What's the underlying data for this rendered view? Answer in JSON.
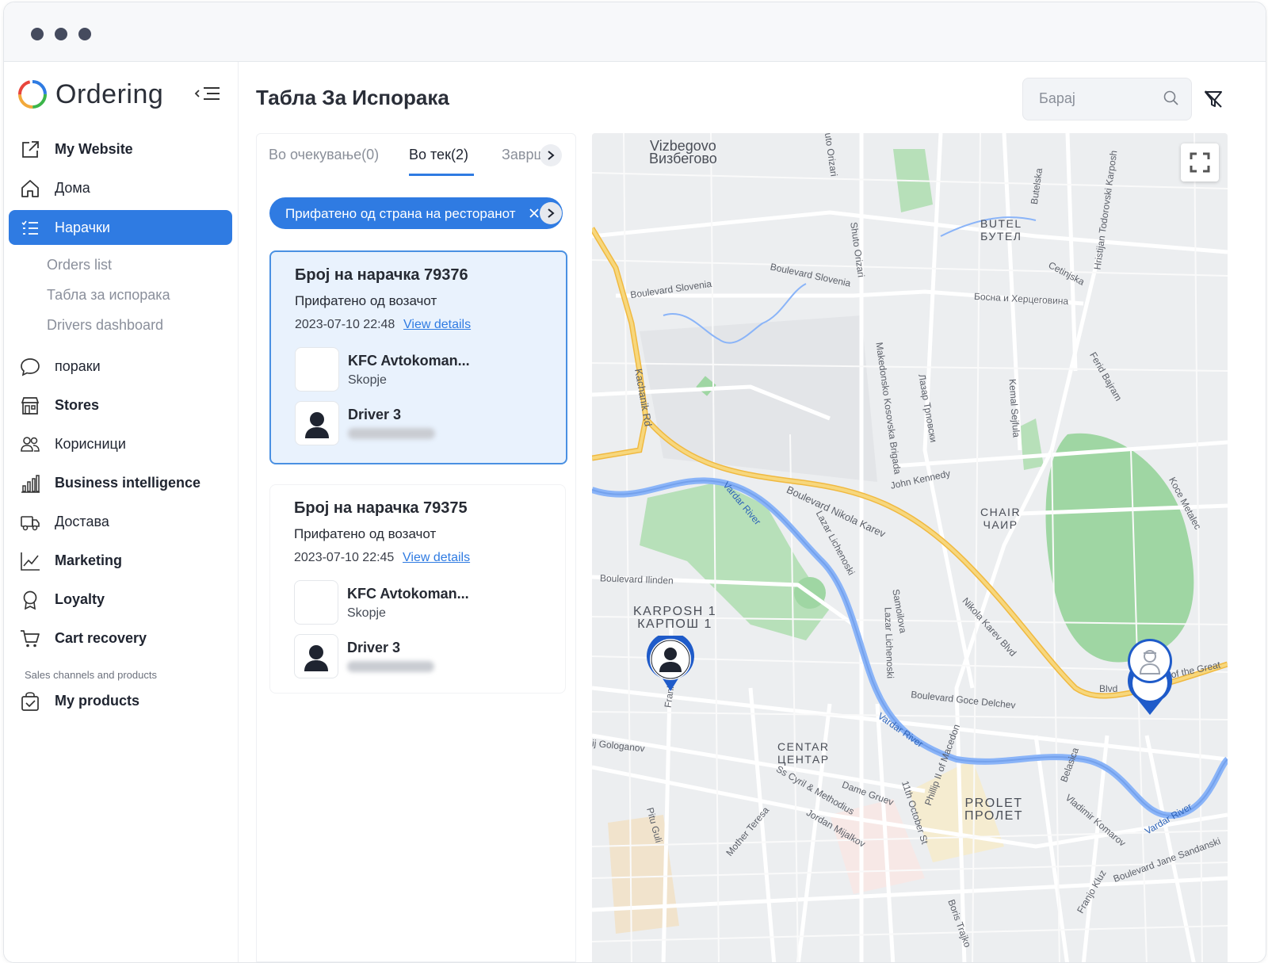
{
  "app": {
    "name": "Ordering"
  },
  "sidebar": {
    "top_items": [
      {
        "label": "My Website",
        "icon": "external-link-icon"
      },
      {
        "label": "Дома",
        "icon": "home-icon"
      },
      {
        "label": "Нарачки",
        "icon": "list-icon",
        "active": true
      }
    ],
    "sub_items": [
      "Orders list",
      "Табла за испорака",
      "Drivers dashboard"
    ],
    "items": [
      {
        "label": "пораки",
        "icon": "chat-bubble-icon"
      },
      {
        "label": "Stores",
        "icon": "store-icon"
      },
      {
        "label": "Корисници",
        "icon": "users-icon"
      },
      {
        "label": "Business intelligence",
        "icon": "bar-chart-icon"
      },
      {
        "label": "Достава",
        "icon": "truck-icon"
      },
      {
        "label": "Marketing",
        "icon": "line-chart-icon"
      },
      {
        "label": "Loyalty",
        "icon": "award-icon"
      },
      {
        "label": "Cart recovery",
        "icon": "cart-icon"
      }
    ],
    "section_label": "Sales channels and products",
    "bottom_items": [
      {
        "label": "My products",
        "icon": "bag-check-icon"
      }
    ]
  },
  "header": {
    "title": "Табла За Испорака",
    "search_placeholder": "Барај"
  },
  "tabs": [
    {
      "label": "Во очекување(0)",
      "active": false
    },
    {
      "label": "Во тек(2)",
      "active": true
    },
    {
      "label": "Заврш",
      "active": false
    }
  ],
  "filter_chip": {
    "label": "Прифатено од страна на ресторанот"
  },
  "orders": [
    {
      "title": "Број на нарачка 79376",
      "status": "Прифатено од возачот",
      "date": "2023-07-10 22:48",
      "link": "View details",
      "store": "KFC Avtokoman...",
      "city": "Skopje",
      "driver": "Driver 3",
      "selected": true
    },
    {
      "title": "Број на нарачка 79375",
      "status": "Прифатено од возачот",
      "date": "2023-07-10 22:45",
      "link": "View details",
      "store": "KFC Avtokoman...",
      "city": "Skopje",
      "driver": "Driver 3",
      "selected": false
    }
  ],
  "map": {
    "districts": [
      "Vizbegovo\nВизбегово",
      "BUTEL\nБУТЕЛ",
      "CHAIR\nЧАИР",
      "KARPOSH 1\nКАРПОШ 1",
      "CENTAR\nЦЕНТАР",
      "PROLET\nПРОЛЕТ"
    ],
    "streets": [
      "Boulevard Slovenia",
      "Boulevard Slovenia",
      "Боснa и Херцеговина",
      "Kachanik Rd",
      "Makedonsko Kosovska Brigada",
      "Лазар Трповски",
      "Kemal Sejfula",
      "Ferid Bajram",
      "Boulevard Nikola Karev",
      "John Kennedy",
      "Vardar River",
      "Lazar Lichenoski",
      "Boulevard Ilinden",
      "Samoilova",
      "Nikola Karev Blvd",
      "Boulevard Goce Delchev",
      "Vardar River",
      "Ss Cyril & Methodius",
      "Dame Gruev",
      "11th October St",
      "Mother Teresa",
      "Jordan Mijalkov",
      "Pitu Guli",
      "Vladimir Komarov",
      "Boulevard Jane Sandanski",
      "Vardar River",
      "Franjo Kluz",
      "Belasica",
      "Boris Trajko",
      "Frankli",
      "Shuto Orizari",
      "Cetinjska",
      "Butelska",
      "Hristijan Todorovski Karposh",
      "Koce Metalec",
      "of the Great",
      "Blvd",
      "Phillip II of Macedon",
      "ij Golog anov",
      "uto Orizari"
    ]
  },
  "colors": {
    "accent": "#2f7be2",
    "card_selected_bg": "#e9f2fd",
    "park": "#9fd6a3",
    "river": "#8ab4f8",
    "highway": "#f3c65f"
  }
}
